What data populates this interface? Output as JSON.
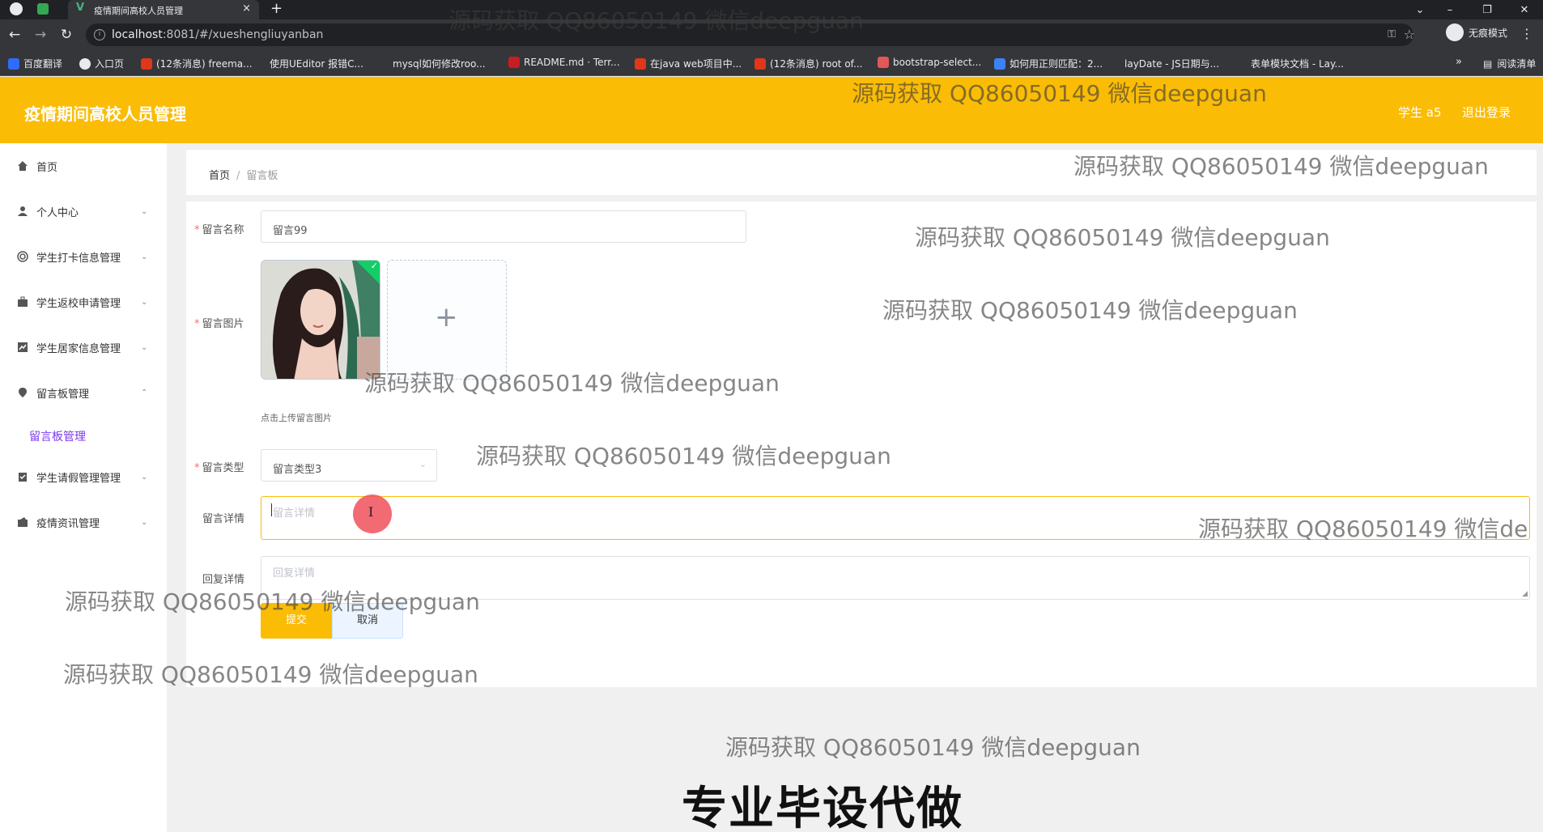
{
  "browser": {
    "tab_title": "疫情期间高校人员管理",
    "tab_close": "×",
    "new_tab": "+",
    "window_min": "–",
    "window_max": "❐",
    "window_close": "✕",
    "url_host": "localhost",
    "url_rest": ":8081/#/xueshengliuyanban",
    "incognito_label": "无痕模式",
    "bookmarks": [
      {
        "label": "百度翻译",
        "color": "#2f6bff"
      },
      {
        "label": "入口页",
        "color": "#e8eaed"
      },
      {
        "label": "(12条消息) freema...",
        "color": "#e0361a"
      },
      {
        "label": "使用UEditor 报错C...",
        "color": "#35363a"
      },
      {
        "label": "mysql如何修改roo...",
        "color": "#35363a"
      },
      {
        "label": "README.md · Terr...",
        "color": "#c71d23"
      },
      {
        "label": "在java web项目中...",
        "color": "#e0361a"
      },
      {
        "label": "(12条消息) root of...",
        "color": "#e0361a"
      },
      {
        "label": "bootstrap-select...",
        "color": "#e05858"
      },
      {
        "label": "如何用正则匹配：2...",
        "color": "#3b82f6"
      },
      {
        "label": "layDate - JS日期与...",
        "color": "#35363a"
      },
      {
        "label": "表单模块文档 - Lay...",
        "color": "#35363a"
      }
    ],
    "bookmarks_more": "»",
    "reading_list": "阅读清单"
  },
  "header": {
    "title": "疫情期间高校人员管理",
    "user": "学生 a5",
    "logout": "退出登录"
  },
  "sidebar": {
    "items": [
      {
        "label": "首页",
        "icon": "home-icon",
        "arrow": ""
      },
      {
        "label": "个人中心",
        "icon": "user-icon",
        "arrow": "⌄"
      },
      {
        "label": "学生打卡信息管理",
        "icon": "circle-icon",
        "arrow": "⌄"
      },
      {
        "label": "学生返校申请管理",
        "icon": "briefcase-icon",
        "arrow": "⌄"
      },
      {
        "label": "学生居家信息管理",
        "icon": "chart-icon",
        "arrow": "⌄"
      },
      {
        "label": "留言板管理",
        "icon": "location-icon",
        "arrow": "⌃"
      },
      {
        "label": "学生请假管理管理",
        "icon": "clipboard-icon",
        "arrow": "⌄"
      },
      {
        "label": "疫情资讯管理",
        "icon": "news-icon",
        "arrow": "⌄"
      }
    ],
    "sub_item": "留言板管理"
  },
  "breadcrumb": {
    "home": "首页",
    "sep": "/",
    "current": "留言板"
  },
  "form": {
    "name_label": "留言名称",
    "name_value": "留言99",
    "image_label": "留言图片",
    "upload_plus": "+",
    "upload_tip": "点击上传留言图片",
    "type_label": "留言类型",
    "type_value": "留言类型3",
    "detail_label": "留言详情",
    "detail_placeholder": "留言详情",
    "reply_label": "回复详情",
    "reply_placeholder": "回复详情",
    "required_mark": "*",
    "submit": "提交",
    "cancel": "取消"
  },
  "watermark": "源码获取 QQ86050149 微信deepguan",
  "watermark_cut": "源码获取 QQ86050149 微信de",
  "ad_text": "专业毕设代做",
  "colors": {
    "accent": "#fbbc05",
    "sidebar_active": "#7c3aed",
    "required": "#f56c6c"
  }
}
